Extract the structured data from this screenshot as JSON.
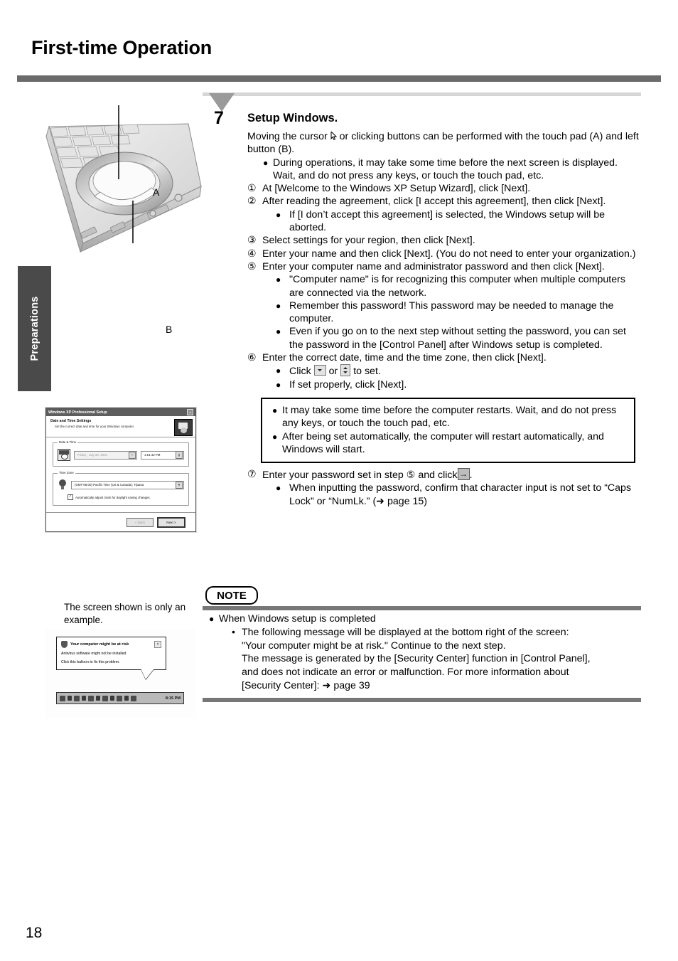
{
  "header": {
    "title": "First-time Operation"
  },
  "side_tab": {
    "label": "Preparations"
  },
  "page_number": "18",
  "figure": {
    "label_a": "A",
    "label_b": "B",
    "caption": "The screen shown is only an example."
  },
  "xp_dialog": {
    "title": "Windows XP Professional Setup",
    "close": "×",
    "heading": "Date and Time Settings",
    "subheading": "Set the correct date and time for your Windows computer.",
    "group_datetime": "Date & Time",
    "date_value": "Friday   ,   July    30, 2004",
    "time_value": "1:51:42 PM",
    "group_timezone": "Time Zone",
    "timezone_value": "(GMT-08:00) Pacific Time (US & Canada); Tijuana",
    "dst_checkbox_label": "Automatically adjust clock for daylight saving changes",
    "dst_checked": "✓",
    "back_button": "< Back",
    "next_button": "Next >"
  },
  "balloon": {
    "title": "Your computer might be at risk",
    "line1": "Antivirus software might not be installed",
    "line2": "Click this balloon to fix this problem.",
    "close": "×",
    "clock": "8:15 PM"
  },
  "step": {
    "number": "7",
    "heading": "Setup Windows.",
    "intro_1": "Moving the cursor",
    "intro_2": "or clicking buttons can be performed with the touch pad (A) and left button (B).",
    "bullet_display": "During operations, it may take some time before the next screen is displayed.",
    "bullet_display_2": "Wait, and do not press any keys, or touch the touch pad, etc.",
    "items": [
      {
        "marker": "①",
        "text": "At [Welcome to the Windows XP Setup Wizard], click [Next]."
      },
      {
        "marker": "②",
        "text": "After reading the agreement, click [I accept this agreement], then click [Next]."
      },
      {
        "marker": "③",
        "text": "Select settings for your region, then click [Next]."
      },
      {
        "marker": "④",
        "text": "Enter your name and then click [Next]. (You do not need to enter your organization.)"
      },
      {
        "marker": "⑤",
        "text": "Enter your computer name and administrator password and then click [Next]."
      },
      {
        "marker": "⑥",
        "text": "Enter the correct date, time and the time zone, then click [Next]."
      }
    ],
    "sub_2a": "If [I don’t accept this agreement] is selected, the Windows setup will be aborted.",
    "sub_5a": "\"Computer name\" is for recognizing this computer when multiple computers are connected via the network.",
    "sub_5b": "Remember this password! This password may be needed to manage the computer.",
    "sub_5c": "Even if you go on to the next step without setting the password, you can set the password in the [Control Panel] after Windows setup is completed.",
    "sub_6a_pre": "Click",
    "sub_6a_mid": "or",
    "sub_6a_post": "to set.",
    "sub_6b": "If set properly, click [Next].",
    "box_bullet_1": "It may take some time before the computer restarts. Wait, and do not press any keys, or touch the touch pad, etc.",
    "box_bullet_2": "After being set automatically, the computer will restart automatically, and Windows will start.",
    "item_7_marker": "⑦",
    "item_7_pre": "Enter your password set in step",
    "item_7_ref": "⑤",
    "item_7_mid": "and click",
    "item_7_post": ".",
    "sub_7a": "When inputting the password, confirm that character input is not set to “Caps Lock” or “NumLk.” (➜ page 15)"
  },
  "note": {
    "badge": "NOTE",
    "bullet": "When Windows setup is completed",
    "sub_marker": "•",
    "sub_line1": "The following message will be displayed at the bottom right of the screen:",
    "sub_line2": "\"Your computer might be at risk.\" Continue to the next step.",
    "sub_line3": "The message is generated by the [Security Center] function in [Control Panel],",
    "sub_line4": "and does not indicate an error or malfunction. For more information about",
    "sub_line5": "[Security Center]: ➜ page 39"
  },
  "colors": {
    "header_rule": "#6b6b6b",
    "tab_bg": "#4a4a4a",
    "note_rule": "#777777",
    "step_rule": "#d6d6d6"
  }
}
